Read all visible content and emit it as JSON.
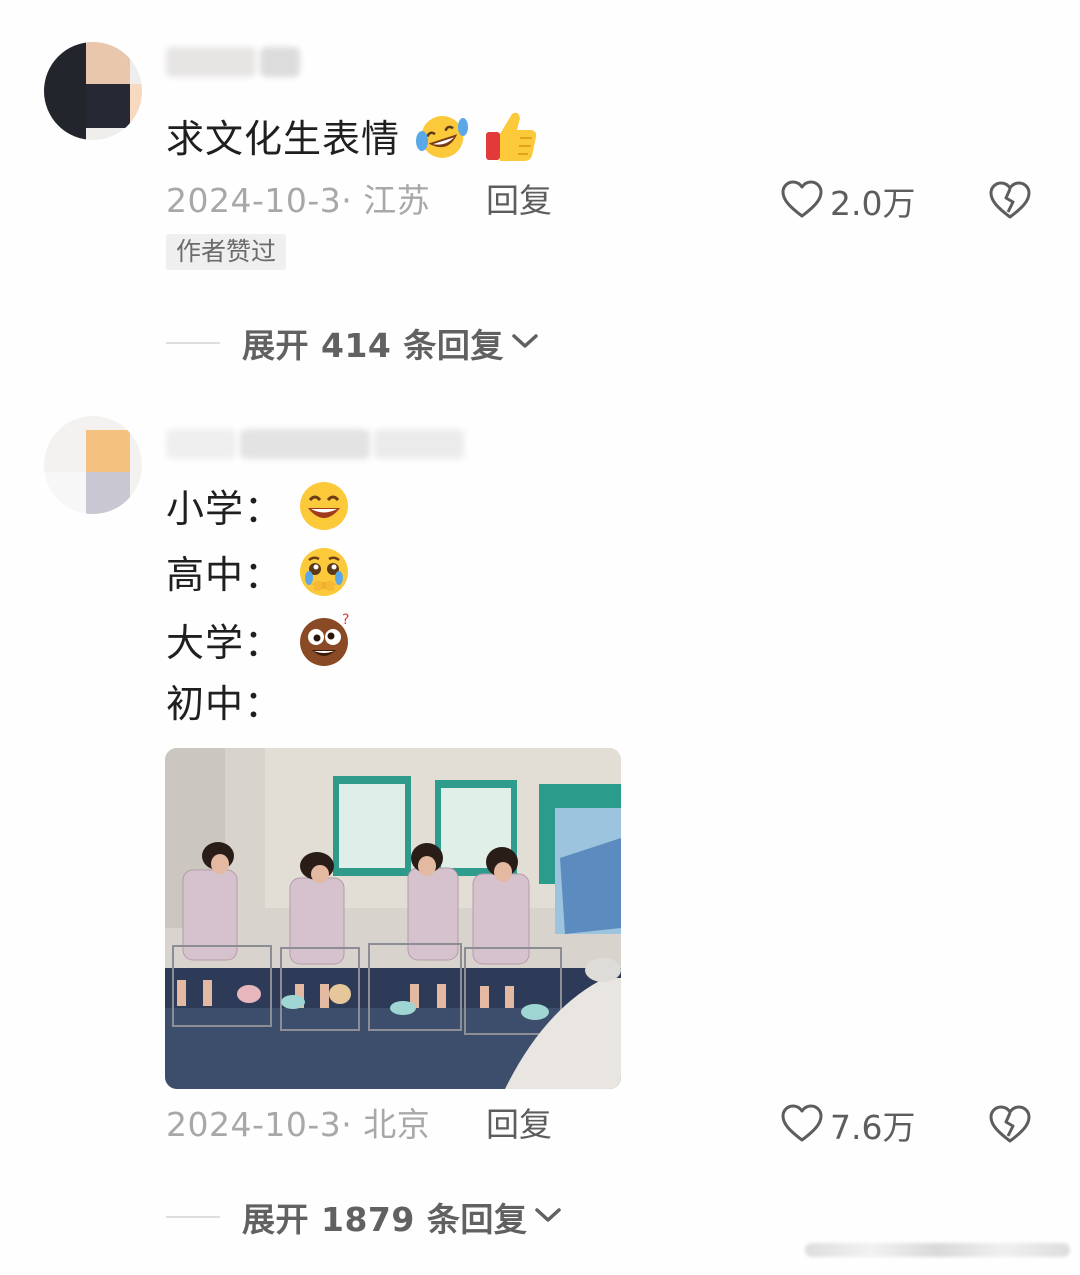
{
  "comments": [
    {
      "text": "求文化生表情",
      "emojis": [
        "rofl-emoji",
        "thumbs-up-emoji"
      ],
      "date_location": "2024-10-3· 江苏",
      "reply_label": "回复",
      "likes": "2.0万",
      "badge": "作者赞过",
      "expand_label": "展开 414 条回复"
    },
    {
      "lines": [
        {
          "label": "小学：",
          "emoji": "grinning-emoji"
        },
        {
          "label": "高中：",
          "emoji": "holding-back-tears-emoji"
        },
        {
          "label": "大学：",
          "emoji": "dazed-brown-face-emoji"
        },
        {
          "label": "初中：",
          "emoji": ""
        }
      ],
      "image": "classroom-mannequins-photo",
      "date_location": "2024-10-3· 北京",
      "reply_label": "回复",
      "likes": "7.6万",
      "expand_label": "展开 1879 条回复"
    }
  ],
  "icons": {
    "like": "heart-outline-icon",
    "dislike": "broken-heart-icon",
    "expand": "chevron-down-icon"
  },
  "colors": {
    "background": "#fefefe",
    "meta_text": "#a8a8a8",
    "action_text": "#5d5d5d"
  }
}
